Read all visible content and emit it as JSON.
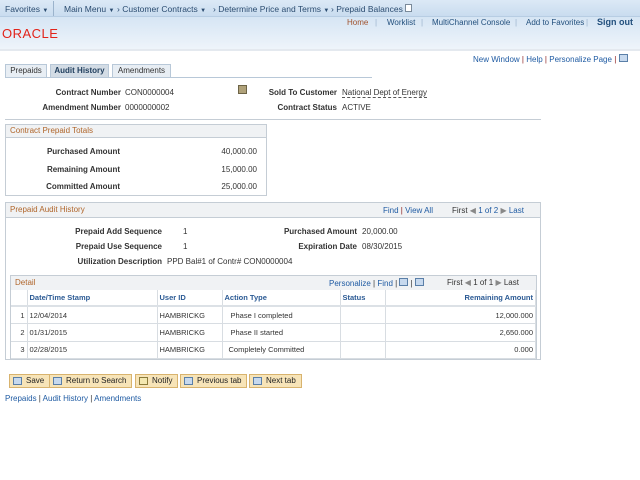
{
  "topnav": {
    "favorites": "Favorites",
    "main_menu": "Main Menu",
    "crumbs": [
      "Customer Contracts",
      "Determine Price and Terms",
      "Prepaid Balances"
    ]
  },
  "header": {
    "links": [
      "Home",
      "Worklist",
      "MultiChannel Console",
      "Add to Favorites",
      "Sign out"
    ],
    "logo": "ORACLE"
  },
  "pagebar": {
    "links": [
      "New Window",
      "Help",
      "Personalize Page"
    ]
  },
  "tabs": [
    {
      "label": "Prepaids"
    },
    {
      "label": "Audit History",
      "active": true
    },
    {
      "label": "Amendments"
    }
  ],
  "contract": {
    "contract_number_label": "Contract Number",
    "contract_number": "CON0000004",
    "amendment_label": "Amendment Number",
    "amendment": "0000000002",
    "sold_to_label": "Sold To Customer",
    "sold_to": "National Dept of Energy",
    "status_label": "Contract Status",
    "status": "ACTIVE"
  },
  "totals": {
    "title": "Contract Prepaid Totals",
    "rows": [
      {
        "label": "Purchased Amount",
        "value": "40,000.00"
      },
      {
        "label": "Remaining Amount",
        "value": "15,000.00"
      },
      {
        "label": "Committed Amount",
        "value": "25,000.00"
      }
    ]
  },
  "audit": {
    "title": "Prepaid Audit History",
    "find": "Find",
    "view_all": "View All",
    "first": "First",
    "count": "1 of 2",
    "last": "Last",
    "add_seq_label": "Prepaid Add Sequence",
    "add_seq": "1",
    "use_seq_label": "Prepaid Use Sequence",
    "use_seq": "1",
    "purchased_label": "Purchased Amount",
    "purchased": "20,000.00",
    "expiration_label": "Expiration Date",
    "expiration": "08/30/2015",
    "util_label": "Utilization Description",
    "util": "PPD Bal#1 of Contr# CON0000004"
  },
  "detail": {
    "title": "Detail",
    "personalize": "Personalize",
    "find": "Find",
    "first": "First",
    "count": "1 of 1",
    "last": "Last",
    "columns": [
      "Date/Time Stamp",
      "User ID",
      "Action Type",
      "Status",
      "Remaining Amount"
    ],
    "rows": [
      {
        "n": "1",
        "date": "12/04/2014",
        "user": "HAMBRICKG",
        "action": "Phase I completed",
        "status": "",
        "remaining": "12,000.000"
      },
      {
        "n": "2",
        "date": "01/31/2015",
        "user": "HAMBRICKG",
        "action": "Phase II started",
        "status": "",
        "remaining": "2,650.000"
      },
      {
        "n": "3",
        "date": "02/28/2015",
        "user": "HAMBRICKG",
        "action": "Completely Committed",
        "status": "",
        "remaining": "0.000"
      }
    ]
  },
  "buttons": [
    "Save",
    "Return to Search",
    "Notify",
    "Previous tab",
    "Next tab"
  ],
  "footer_links": [
    "Prepaids",
    "Audit History",
    "Amendments"
  ]
}
